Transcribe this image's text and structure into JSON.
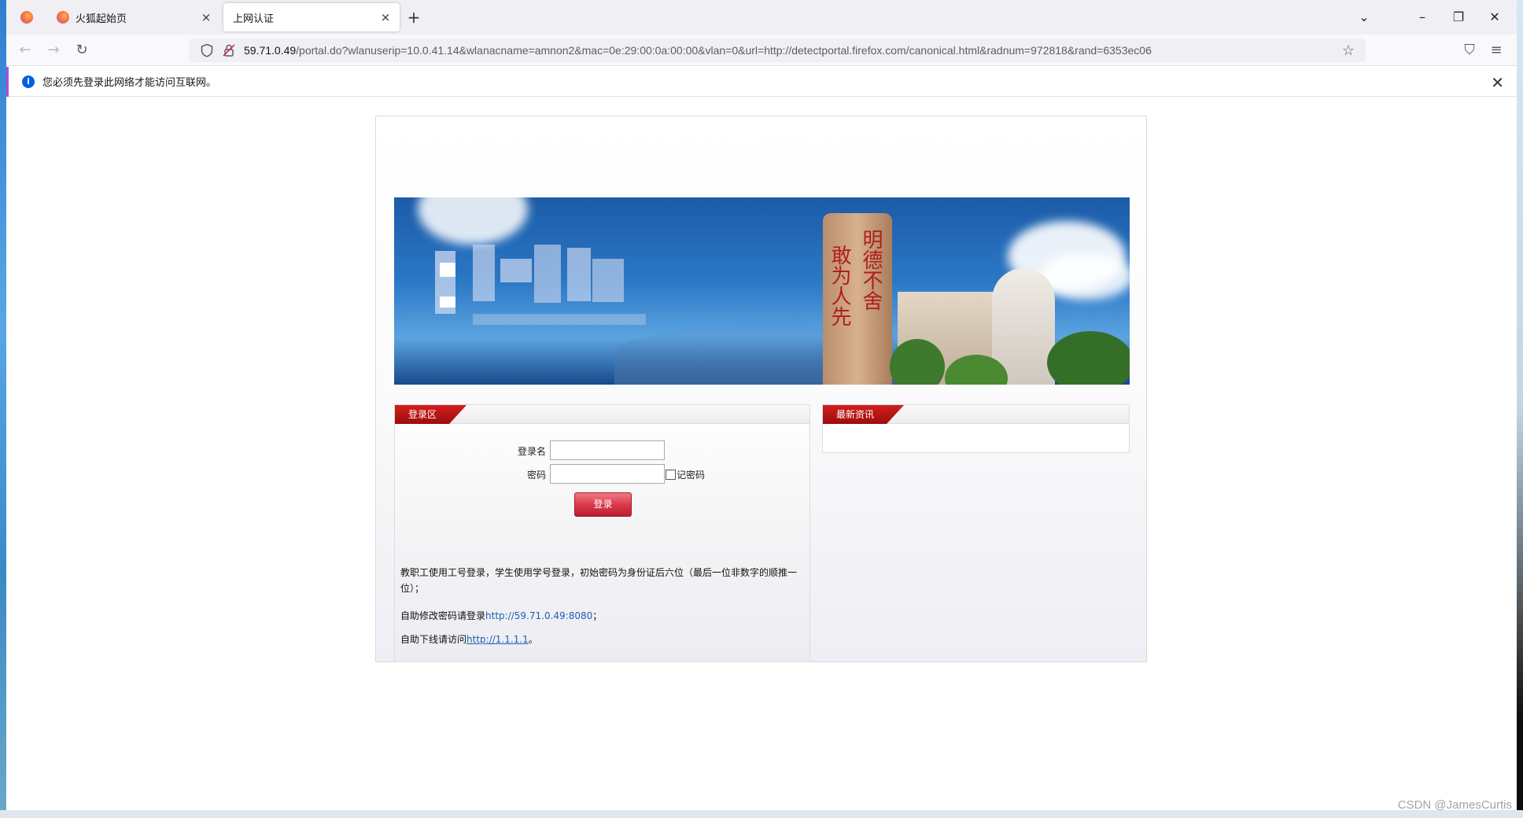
{
  "browser": {
    "tabs": [
      {
        "title": "",
        "pinned": true
      },
      {
        "title": "火狐起始页",
        "close": "×"
      },
      {
        "title": "上网认证",
        "close": "×",
        "active": true
      }
    ],
    "new_tab": "+",
    "window_controls": {
      "minimize": "–",
      "restore": "❐",
      "close": "✕",
      "list": "⌄"
    },
    "nav": {
      "back": "←",
      "forward": "→",
      "reload": "↻"
    },
    "url": {
      "host": "59.71.0.49",
      "rest": "/portal.do?wlanuserip=10.0.41.14&wlanacname=amnon2&mac=0e:29:00:0a:00:00&vlan=0&url=http://detectportal.firefox.com/canonical.html&radnum=972818&rand=6353ec06"
    },
    "bookmark_star": "☆",
    "pocket": "⛉",
    "menu": "≡"
  },
  "notification": {
    "icon": "i",
    "text": "您必须先登录此网络才能访问互联网。",
    "close": "✕"
  },
  "portal": {
    "banner": {
      "stone_text_right": "明德不舍",
      "stone_text_left": "敢为人先"
    },
    "login_panel": {
      "title": "登录区",
      "username_label": "登录名",
      "username_value": "",
      "password_label": "密码",
      "password_value": "",
      "remember_label": "记密码",
      "remember_checked": false,
      "login_button": "登录"
    },
    "news_panel": {
      "title": "最新资讯"
    },
    "notes": {
      "line1": "教职工使用工号登录，学生使用学号登录，初始密码为身份证后六位（最后一位非数字的顺推一位）；",
      "line2_prefix": "自助修改密码请登录",
      "line2_link": "http://59.71.0.49:8080",
      "line2_suffix": "；",
      "line3_prefix": "自助下线请访问",
      "line3_link": "http://1.1.1.1",
      "line3_suffix": "。"
    }
  },
  "watermark": "CSDN @JamesCurtis",
  "colors": {
    "accent_red": "#b91c30",
    "panel_tab_red": "#9b0d0d",
    "link_blue": "#1d5fb4",
    "firefox_info_blue": "#0060df"
  }
}
